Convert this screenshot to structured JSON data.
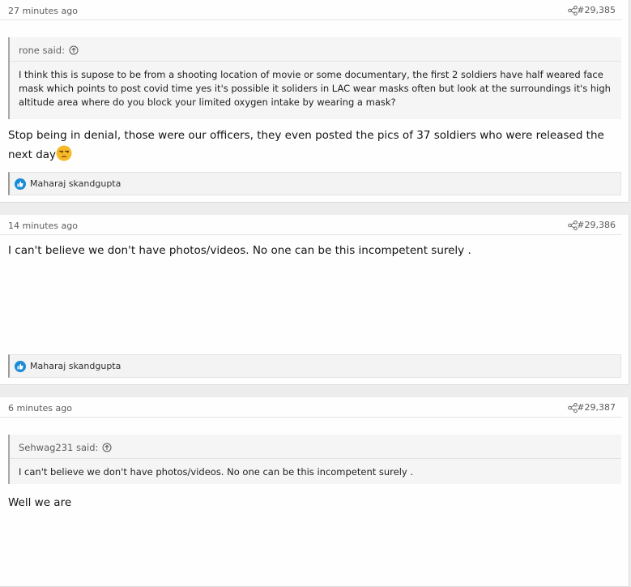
{
  "posts": [
    {
      "time": "27 minutes ago",
      "number": "#29,385",
      "quote": {
        "author_line": "rone said:",
        "text": "I think this is supose to be from a shooting location of movie or some documentary, the first 2 soldiers have half weared face mask which points to post covid time yes it's possible it soliders in LAC wear masks often but look at the surroundings it's high altitude area where do you block your limited oxygen intake by wearing a mask?"
      },
      "message": "Stop being in denial, those were our officers, they even posted the pics of 37 soldiers who were released the next day",
      "emoji": "unamused-face-emoji",
      "reactions": "Maharaj skandgupta"
    },
    {
      "time": "14 minutes ago",
      "number": "#29,386",
      "message": "I can't believe we don't have photos/videos. No one can be this incompetent surely .",
      "reactions": "Maharaj skandgupta"
    },
    {
      "time": "6 minutes ago",
      "number": "#29,387",
      "quote": {
        "author_line": "Sehwag231 said:",
        "text": "I can't believe we don't have photos/videos. No one can be this incompetent surely ."
      },
      "message": "Well we are"
    }
  ],
  "icons": {
    "share": "share-icon",
    "quote_jump": "arrow-up-circle-icon",
    "like": "like-icon"
  },
  "colors": {
    "like_blue": "#1a8bd6",
    "emoji_yellow": "#f7b928"
  }
}
